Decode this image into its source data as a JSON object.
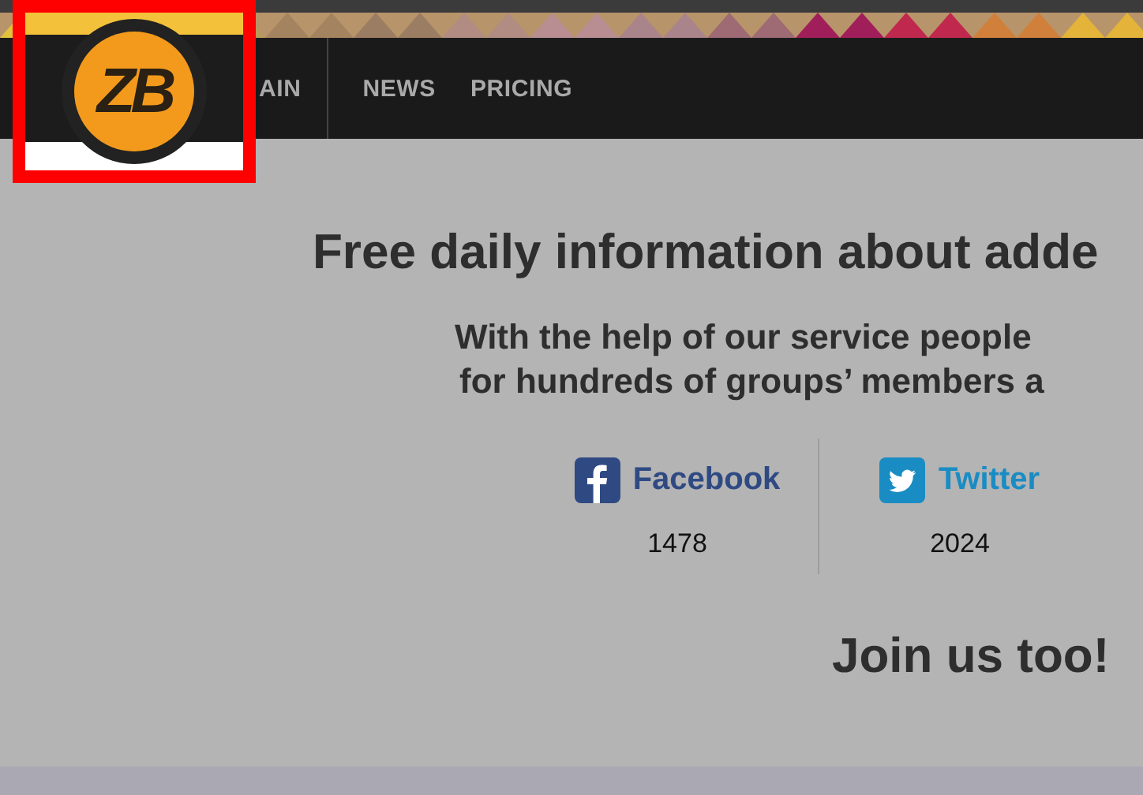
{
  "logo": {
    "text": "ZB"
  },
  "nav": {
    "items": [
      {
        "label": "AIN"
      },
      {
        "label": "NEWS"
      },
      {
        "label": "PRICING"
      }
    ]
  },
  "headline": "Free daily information about adde",
  "subtitle": [
    "With the help of our service people",
    "for hundreds of groups’ members a"
  ],
  "social": [
    {
      "kind": "facebook",
      "label": "Facebook",
      "count": "1478"
    },
    {
      "kind": "twitter",
      "label": "Twitter",
      "count": "2024"
    }
  ],
  "cta": "Join us too!"
}
